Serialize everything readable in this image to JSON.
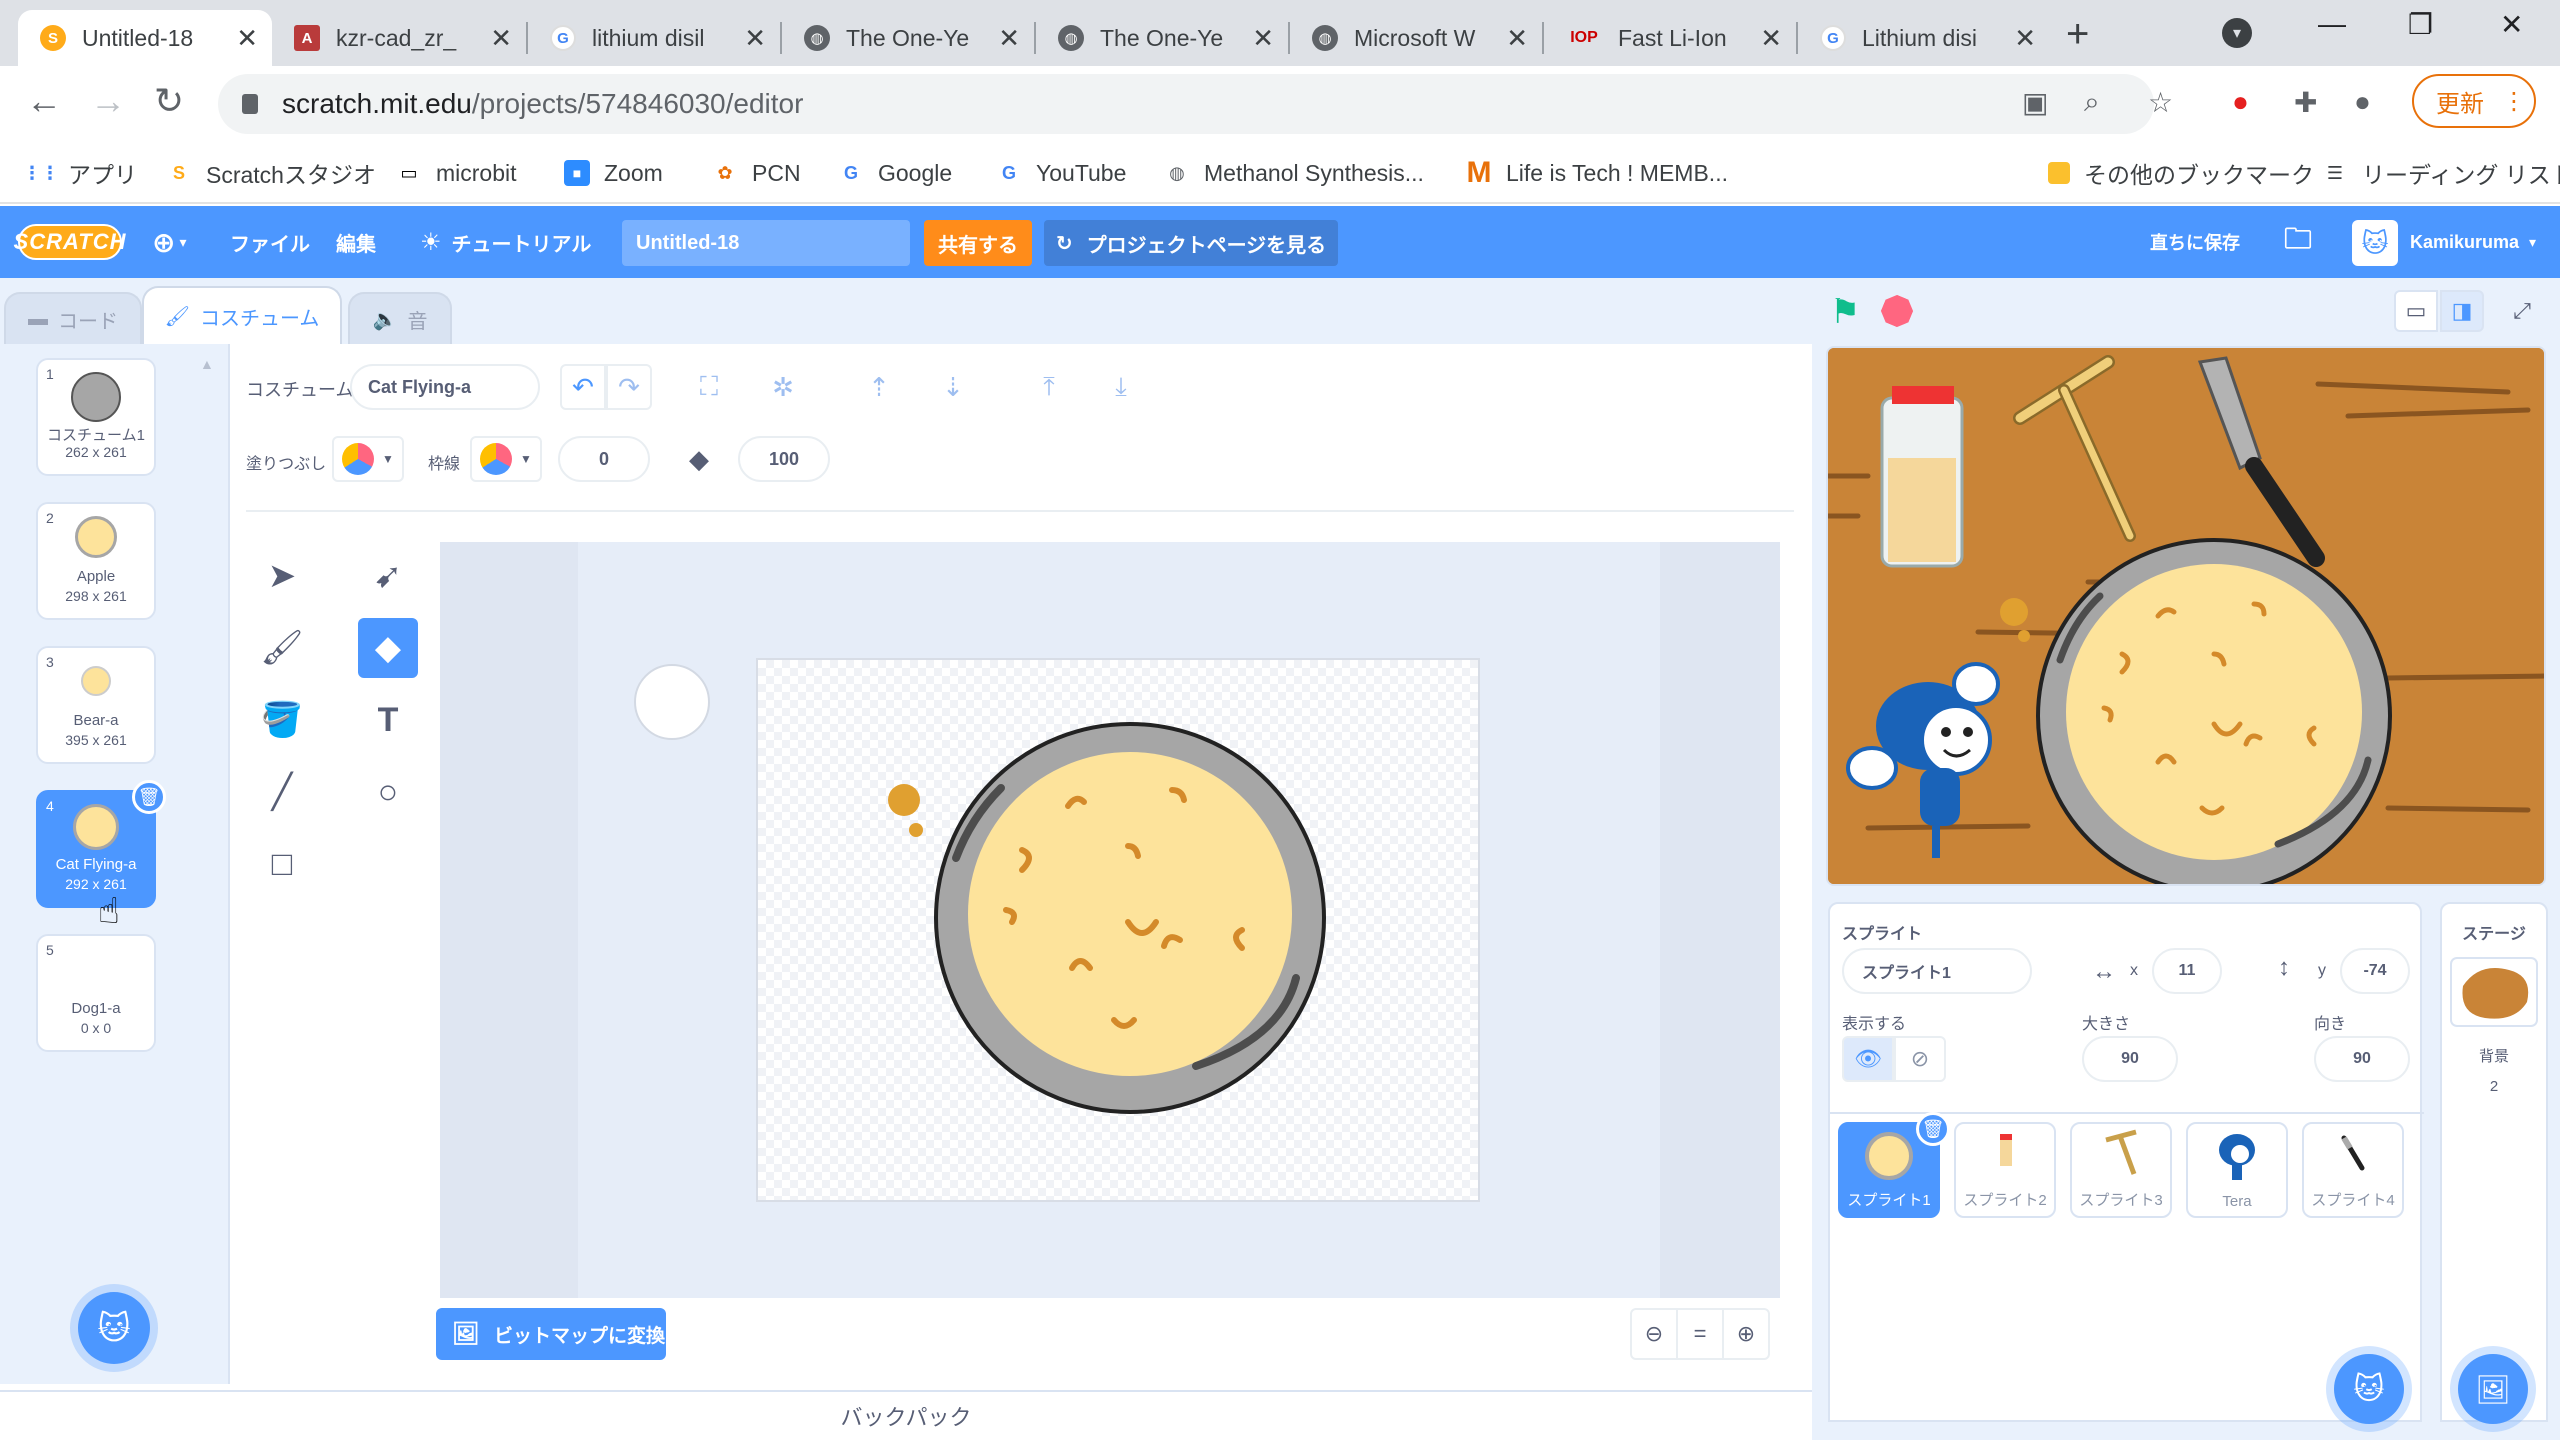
{
  "browser": {
    "tabs": [
      {
        "title": "Untitled-18",
        "favicon": "scratch-icon",
        "active": true
      },
      {
        "title": "kzr-cad_zr_",
        "favicon": "pdf-icon"
      },
      {
        "title": "lithium disil",
        "favicon": "google-icon"
      },
      {
        "title": "The One-Ye",
        "favicon": "globe-icon"
      },
      {
        "title": "The One-Ye",
        "favicon": "globe-icon"
      },
      {
        "title": "Microsoft W",
        "favicon": "globe-icon"
      },
      {
        "title": "Fast Li-Ion",
        "favicon": "iop-icon"
      },
      {
        "title": "Lithium disi",
        "favicon": "google-icon"
      }
    ],
    "url_host": "scratch.mit.edu",
    "url_path": "/projects/574846030/editor",
    "update_label": "更新",
    "bookmarks": [
      {
        "label": "アプリ",
        "icon": "apps-icon"
      },
      {
        "label": "Scratchスタジオ",
        "icon": "scratch-icon"
      },
      {
        "label": "microbit",
        "icon": "microbit-icon"
      },
      {
        "label": "Zoom",
        "icon": "zoom-icon"
      },
      {
        "label": "PCN",
        "icon": "pcn-icon"
      },
      {
        "label": "Google",
        "icon": "google-icon"
      },
      {
        "label": "YouTube",
        "icon": "google-icon"
      },
      {
        "label": "Methanol Synthesis...",
        "icon": "globe-icon"
      },
      {
        "label": "Life is Tech ! MEMB...",
        "icon": "m-icon"
      }
    ],
    "other_bookmarks": "その他のブックマーク",
    "reading_list": "リーディング リスト"
  },
  "menubar": {
    "logo": "SCRATCH",
    "file": "ファイル",
    "edit": "編集",
    "tutorial": "チュートリアル",
    "project_title": "Untitled-18",
    "share": "共有する",
    "see_project_page": "プロジェクトページを見る",
    "save_now": "直ちに保存",
    "username": "Kamikuruma"
  },
  "editor_tabs": {
    "code": "コード",
    "costumes": "コスチューム",
    "sounds": "音"
  },
  "costumes": [
    {
      "num": "1",
      "name": "コスチューム1",
      "size": "262 x 261"
    },
    {
      "num": "2",
      "name": "Apple",
      "size": "298 x 261"
    },
    {
      "num": "3",
      "name": "Bear-a",
      "size": "395 x 261"
    },
    {
      "num": "4",
      "name": "Cat Flying-a",
      "size": "292 x 261",
      "selected": true
    },
    {
      "num": "5",
      "name": "Dog1-a",
      "size": "0 x 0"
    }
  ],
  "paint": {
    "costume_label": "コスチューム",
    "costume_name": "Cat Flying-a",
    "fill_label": "塗りつぶし",
    "outline_label": "枠線",
    "outline_width": "0",
    "eraser_size": "100",
    "convert_bitmap": "ビットマップに変換"
  },
  "backpack": "バックパック",
  "sprite_info": {
    "sprite_label": "スプライト",
    "sprite_name": "スプライト1",
    "x_label": "x",
    "x": "11",
    "y_label": "y",
    "y": "-74",
    "show_label": "表示する",
    "size_label": "大きさ",
    "size": "90",
    "direction_label": "向き",
    "direction": "90"
  },
  "sprites": [
    {
      "name": "スプライト1",
      "selected": true
    },
    {
      "name": "スプライト2"
    },
    {
      "name": "スプライト3"
    },
    {
      "name": "Tera"
    },
    {
      "name": "スプライト4"
    }
  ],
  "stage_panel": {
    "title": "ステージ",
    "backdrops_label": "背景",
    "backdrops_count": "2"
  },
  "colors": {
    "scratch_blue": "#4c97ff",
    "share_orange": "#ff8c1a",
    "pancake": "#fde39b",
    "pan": "#a6a6a6",
    "wood": "#c98437"
  }
}
